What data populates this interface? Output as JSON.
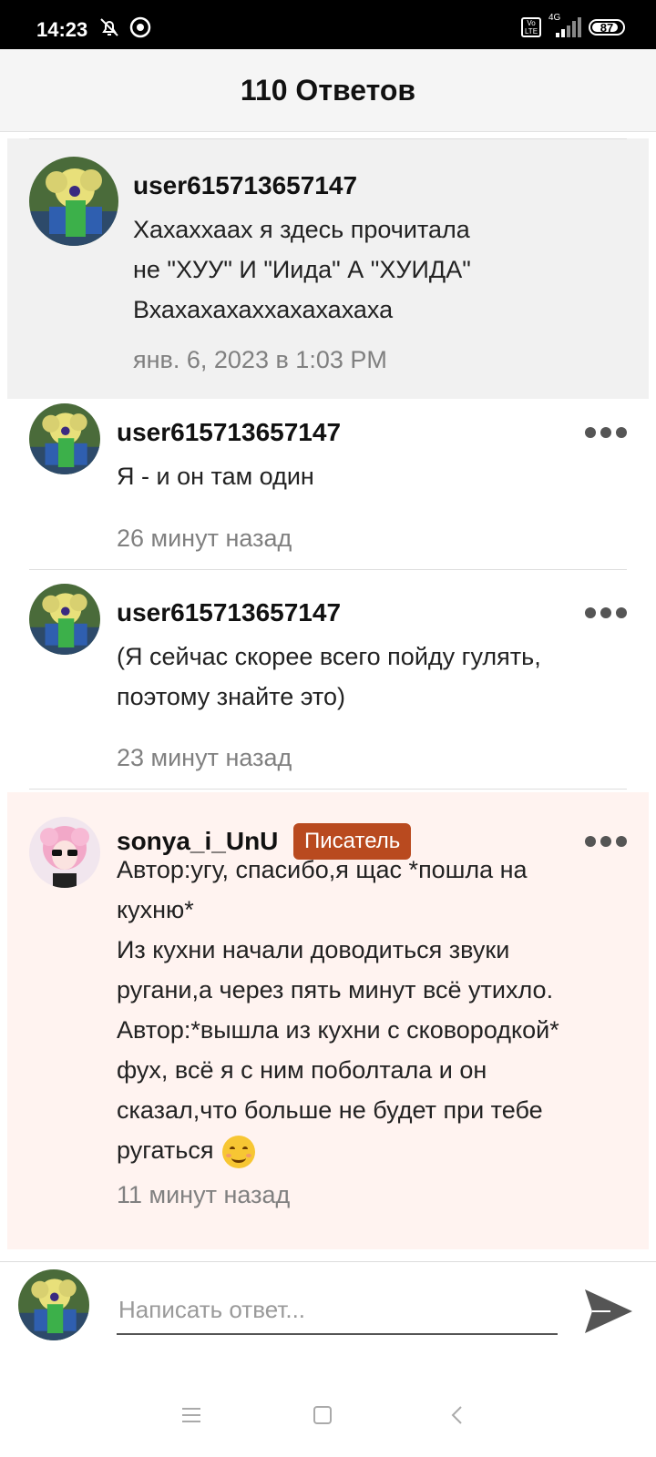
{
  "status_bar": {
    "time": "14:23",
    "network": "4G",
    "volte": "Vo LTE",
    "battery": "87",
    "battery_level": 0.87,
    "icons": [
      "notifications-off-icon",
      "chrome-icon",
      "volte-icon",
      "signal-icon",
      "battery-icon"
    ]
  },
  "header": {
    "title": "110 Ответов"
  },
  "post": {
    "user": "user615713657147",
    "text": "Хахаххаах я здесь прочитала\nне \"ХУУ\" И \"Иида\" А \"ХУИДА\"\nВхахахахаххахахахаха",
    "time": "янв. 6, 2023 в 1:03 PM"
  },
  "replies": [
    {
      "user": "user615713657147",
      "text": "Я - и он там один",
      "time": "26 минут назад"
    },
    {
      "user": "user615713657147",
      "text": "(Я сейчас скорее всего пойду гулять,\nпоэтому знайте это)",
      "time": "23 минут назад"
    },
    {
      "user": "sonya_i_UnU",
      "badge": "Писатель",
      "text": "Автор:угу, спасибо,я щас *пошла на\nкухню*\nИз кухни начали доводиться звуки\nругани,а через пять минут всё утихло.\nАвтор:*вышла из кухни с сковородкой*\nфух, всё я с ним поболтала и он\nсказал,что больше не будет при тебе\nругаться",
      "time": "11 минут назад"
    }
  ],
  "compose": {
    "placeholder": "Написать ответ..."
  },
  "colors": {
    "badge": "#b94a1f",
    "highlight_bg": "#fff3f0",
    "post_bg": "#f1f1f1"
  }
}
